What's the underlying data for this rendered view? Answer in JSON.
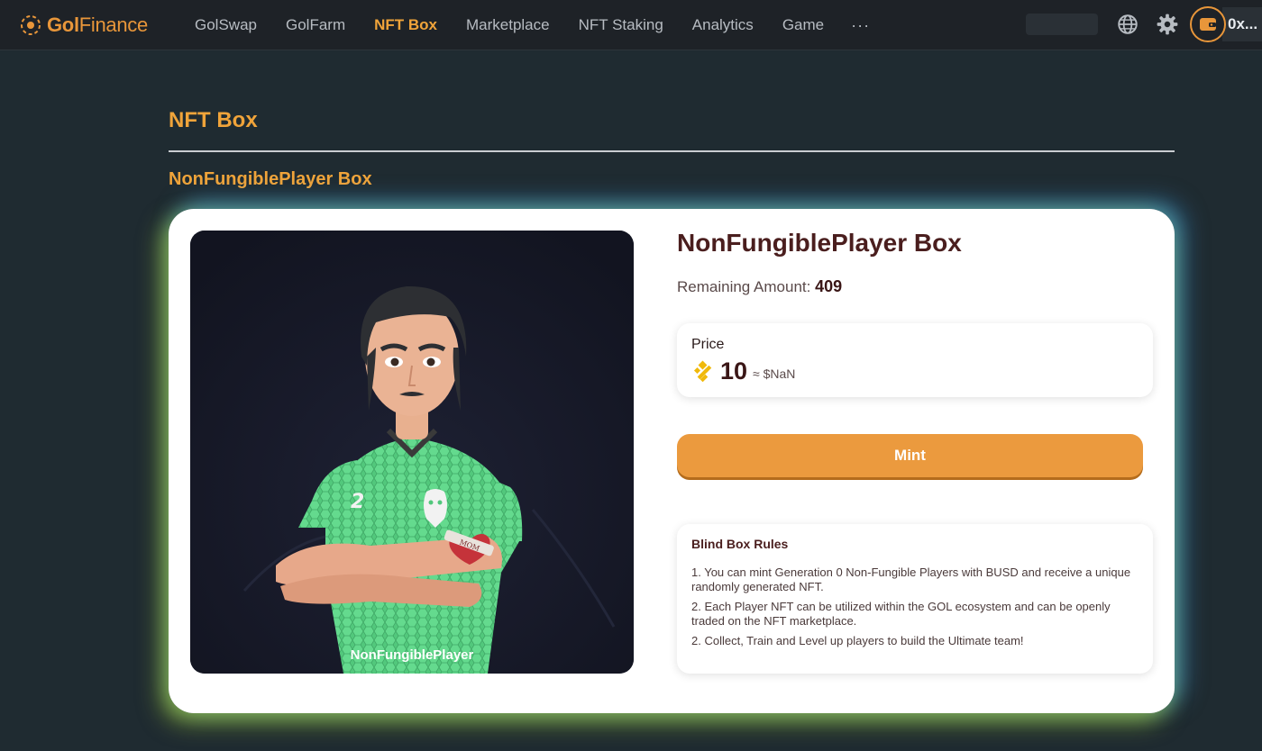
{
  "brand": {
    "gol": "Gol",
    "finance": "Finance"
  },
  "nav": {
    "items": [
      "GolSwap",
      "GolFarm",
      "NFT Box",
      "Marketplace",
      "NFT Staking",
      "Analytics",
      "Game"
    ],
    "active": "NFT Box",
    "more_label": "···"
  },
  "toolbar": {
    "language_icon": "globe-icon",
    "settings_icon": "gear-icon",
    "wallet_icon": "wallet-icon",
    "wallet_address": "0x..."
  },
  "page": {
    "title": "NFT Box",
    "section_title": "NonFungiblePlayer Box"
  },
  "box": {
    "image_caption": "NonFungiblePlayer",
    "jersey_number": "2",
    "tattoo_text": "MOM",
    "name": "NonFungiblePlayer Box",
    "remaining_label": "Remaining Amount:",
    "remaining_value": "409",
    "price_label": "Price",
    "price_value": "10",
    "price_usd": "≈ $NaN",
    "currency_icon": "busd-icon",
    "mint_label": "Mint"
  },
  "rules": {
    "title": "Blind Box Rules",
    "items": [
      "1. You can mint Generation 0 Non-Fungible Players with BUSD and receive a unique randomly generated NFT.",
      "2. Each Player NFT can be utilized within the GOL ecosystem and can be openly traded on the NFT marketplace.",
      "2. Collect, Train and Level up players to build the Ultimate team!"
    ]
  },
  "colors": {
    "accent": "#f0a43a",
    "mint": "#eb9a3e",
    "background": "#1f2b31",
    "jersey": "#5fd48a"
  }
}
